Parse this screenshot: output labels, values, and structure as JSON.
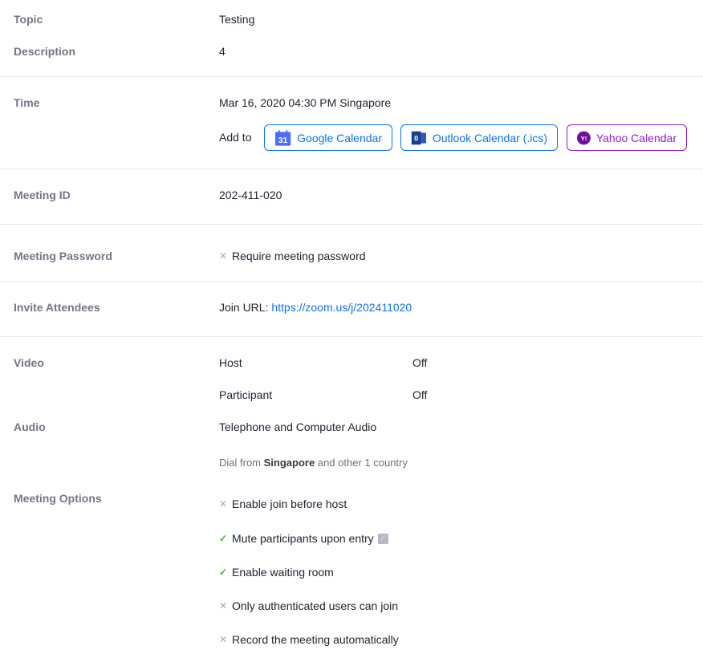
{
  "topic": {
    "label": "Topic",
    "value": "Testing"
  },
  "description": {
    "label": "Description",
    "value": "4"
  },
  "time": {
    "label": "Time",
    "value": "Mar 16, 2020 04:30 PM Singapore",
    "add_to_label": "Add to",
    "google": {
      "label": "Google Calendar",
      "icon_text": "31"
    },
    "outlook": {
      "label": "Outlook Calendar (.ics)",
      "icon_text": "0"
    },
    "yahoo": {
      "label": "Yahoo Calendar",
      "icon_text": "Y!"
    }
  },
  "meeting_id": {
    "label": "Meeting ID",
    "value": "202-411-020"
  },
  "password": {
    "label": "Meeting Password",
    "option": "Require meeting password"
  },
  "invite": {
    "label": "Invite Attendees",
    "prefix": "Join URL:",
    "url": "https://zoom.us/j/202411020"
  },
  "video": {
    "label": "Video",
    "host_label": "Host",
    "host_value": "Off",
    "participant_label": "Participant",
    "participant_value": "Off"
  },
  "audio": {
    "label": "Audio",
    "value": "Telephone and Computer Audio",
    "dial_prefix": "Dial from",
    "dial_country": "Singapore",
    "dial_suffix": "and other 1 country"
  },
  "meeting_options": {
    "label": "Meeting Options",
    "items": [
      {
        "text": "Enable join before host",
        "enabled": false
      },
      {
        "text": "Mute participants upon entry",
        "enabled": true
      },
      {
        "text": "Enable waiting room",
        "enabled": true
      },
      {
        "text": "Only authenticated users can join",
        "enabled": false
      },
      {
        "text": "Record the meeting automatically",
        "enabled": false
      }
    ]
  },
  "colors": {
    "accent": "#0e72ed",
    "yahoo": "#8d1ec7",
    "check": "#35b335",
    "label": "#747487"
  }
}
